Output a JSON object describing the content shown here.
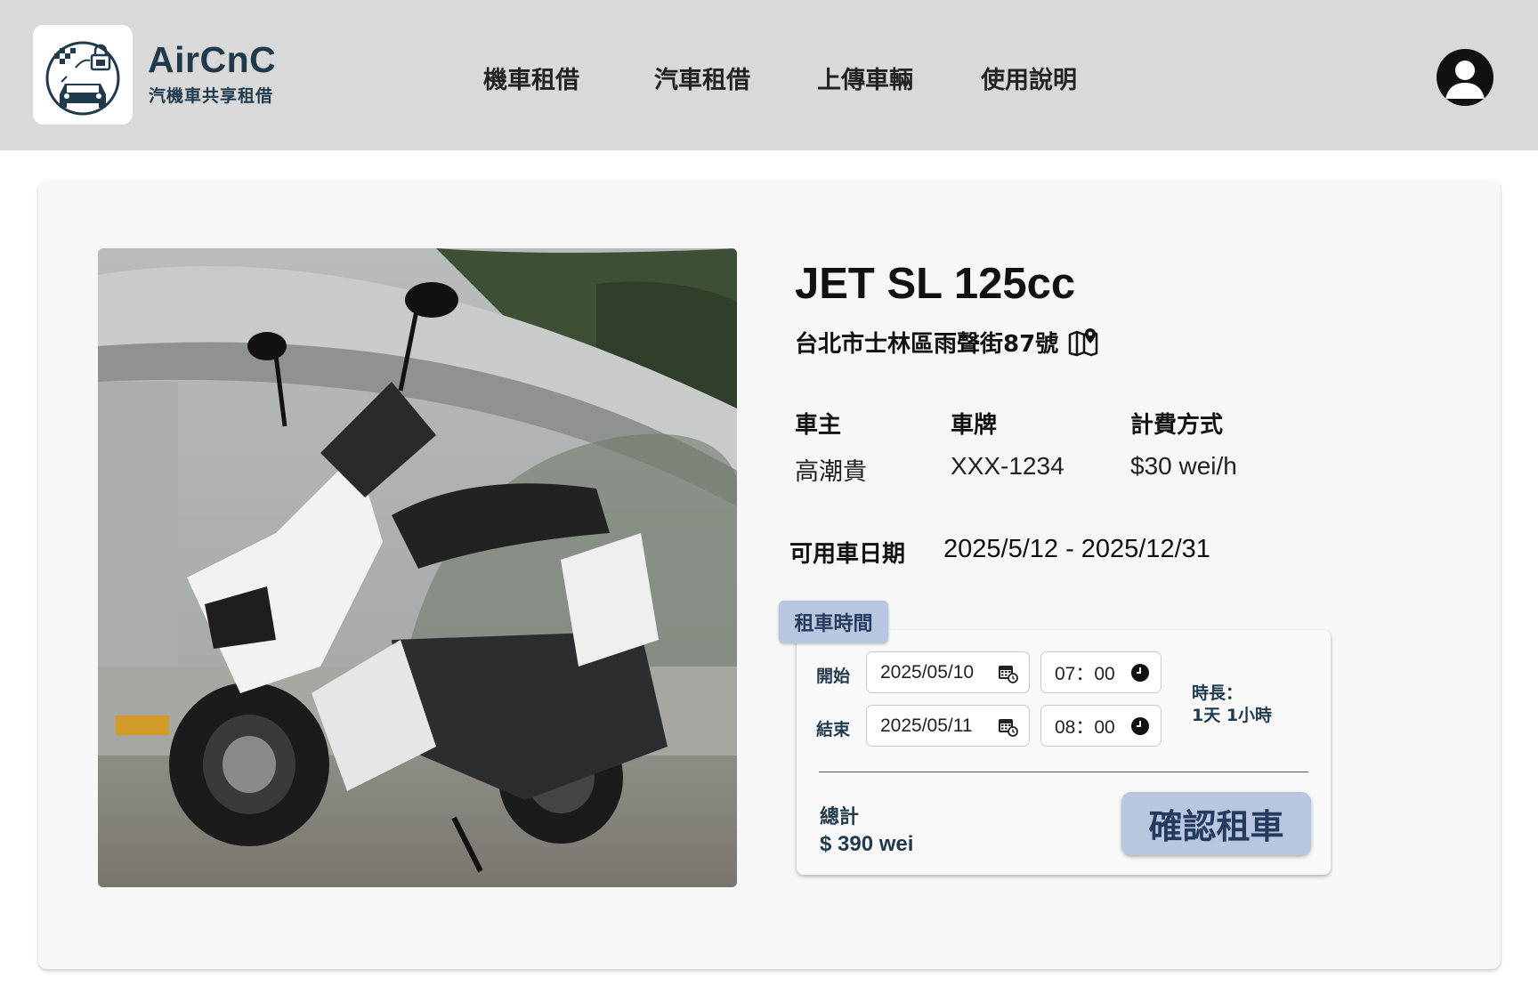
{
  "brand": {
    "title": "AirCnC",
    "subtitle": "汽機車共享租借",
    "color": "#1f3a4d"
  },
  "nav": {
    "items": [
      {
        "label": "機車租借"
      },
      {
        "label": "汽車租借"
      },
      {
        "label": "上傳車輛"
      },
      {
        "label": "使用說明"
      }
    ]
  },
  "vehicle": {
    "name": "JET SL 125cc",
    "address": "台北市士林區雨聲街87號",
    "address_icon": "map-pin-icon",
    "owner_label": "車主",
    "owner": "高潮貴",
    "plate_label": "車牌",
    "plate": "XXX-1234",
    "rate_label": "計費方式",
    "rate": "$30 wei/h",
    "availability_label": "可用車日期",
    "availability": "2025/5/12 - 2025/12/31"
  },
  "booking": {
    "tab_label": "租車時間",
    "start_label": "開始",
    "start_date": "2025/05/10",
    "start_time": "07：00",
    "end_label": "結束",
    "end_date": "2025/05/11",
    "end_time": "08：00",
    "duration_label": "時長：",
    "duration": "1天 1小時",
    "total_label": "總計",
    "total": "$ 390 wei",
    "confirm_label": "確認租車",
    "accent": "#b9c6df"
  }
}
